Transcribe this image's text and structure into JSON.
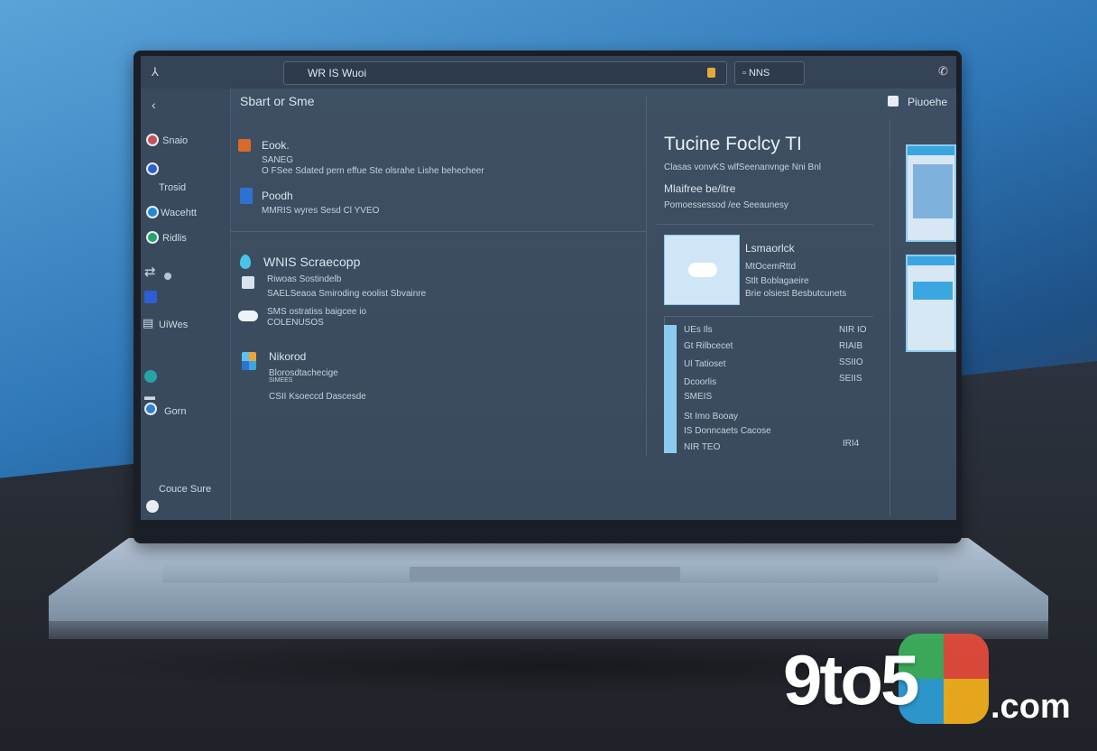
{
  "topbar": {
    "search_text": "WR IS Wuoi",
    "pill_text": "▫ NNS"
  },
  "sidebar": {
    "back_label": "‹",
    "items": [
      "Snaio",
      "Trosid",
      "Wacehtt",
      "Ridlis",
      "UiWes",
      "Gorn"
    ],
    "footer": "Couce Sure"
  },
  "main": {
    "header": "Sbart or Sme",
    "sec1_title": "Eook.",
    "sec1_l1": "SANEG",
    "sec1_l2": "O FSee Sdated pern effue Ste olsrahe Lishe behecheer",
    "sec2_title": "Poodh",
    "sec2_l1": "MMRIS wyres Sesd Cl YVEO",
    "sec3_title": "WNIS Scraecopp",
    "sec3_l1": "Riwoas Sostindelb",
    "sec3_l2": "SAELSeaoa Smiroding eoolist Sbvainre",
    "sec3_l3": "SMS ostratiss baigcee io",
    "sec3_l4": "COLENUSOS",
    "sec4_title": "Nikorod",
    "sec4_l1": "Blorosdtachecige",
    "sec4_l2": "SIMEES",
    "sec4_l3": "CSII Ksoeccd Dascesde"
  },
  "right": {
    "title": "Tucine Foclcy TI",
    "sub": "Clasas vonvKS wlfSeenanvnge Nni Bnl",
    "tag": "Mlaifree be/itre",
    "desc": "Pomoessessod /ee Seeaunesy",
    "card_l1": "Lsmaorlck",
    "card_l2": "MtOcemRttd",
    "card_l3": "Stlt Boblagaeire",
    "card_l4": "Brie olsiest Besbutcunets",
    "list": [
      {
        "left": "UEs Ils",
        "right": "NIR IO"
      },
      {
        "left": "Gt Rilbcecet",
        "right": "RIAIB"
      },
      {
        "left": "Ul Tatioset",
        "right": "SSIIO"
      },
      {
        "left": "Dcoorlis",
        "right": "SEIIS"
      },
      {
        "left": "SMEIS",
        "right": ""
      },
      {
        "left": "St Imo Booay",
        "right": ""
      },
      {
        "left": "IS Donncaets Cacose",
        "right": ""
      },
      {
        "left": "NIR TEO",
        "right": "IRI4"
      }
    ],
    "top_right_label": "Piuoehe"
  },
  "logo": {
    "word": "9to5",
    "com": ".com"
  },
  "colors": {
    "accent": "#3aa6e0",
    "light_accent": "#8ccbf0",
    "screen_bg": "#3f5064"
  }
}
